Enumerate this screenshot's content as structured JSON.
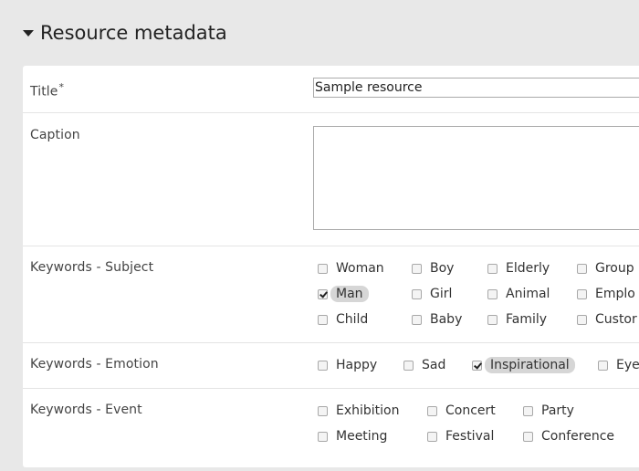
{
  "section": {
    "title": "Resource metadata"
  },
  "title_field": {
    "label": "Title",
    "required_mark": "*",
    "value": "Sample resource"
  },
  "caption_field": {
    "label": "Caption",
    "value": ""
  },
  "keywords_subject": {
    "label": "Keywords - Subject",
    "options": [
      {
        "label": "Woman",
        "checked": false
      },
      {
        "label": "Boy",
        "checked": false
      },
      {
        "label": "Elderly",
        "checked": false
      },
      {
        "label": "Group",
        "checked": false
      },
      {
        "label": "Man",
        "checked": true
      },
      {
        "label": "Girl",
        "checked": false
      },
      {
        "label": "Animal",
        "checked": false
      },
      {
        "label": "Emplo",
        "checked": false
      },
      {
        "label": "Child",
        "checked": false
      },
      {
        "label": "Baby",
        "checked": false
      },
      {
        "label": "Family",
        "checked": false
      },
      {
        "label": "Custor",
        "checked": false
      }
    ]
  },
  "keywords_emotion": {
    "label": "Keywords - Emotion",
    "options": [
      {
        "label": "Happy",
        "checked": false
      },
      {
        "label": "Sad",
        "checked": false
      },
      {
        "label": "Inspirational",
        "checked": true
      },
      {
        "label": "Eye",
        "checked": false
      }
    ]
  },
  "keywords_event": {
    "label": "Keywords - Event",
    "options": [
      {
        "label": "Exhibition",
        "checked": false
      },
      {
        "label": "Concert",
        "checked": false
      },
      {
        "label": "Party",
        "checked": false
      },
      {
        "label": "Meeting",
        "checked": false
      },
      {
        "label": "Festival",
        "checked": false
      },
      {
        "label": "Conference",
        "checked": false
      }
    ]
  }
}
